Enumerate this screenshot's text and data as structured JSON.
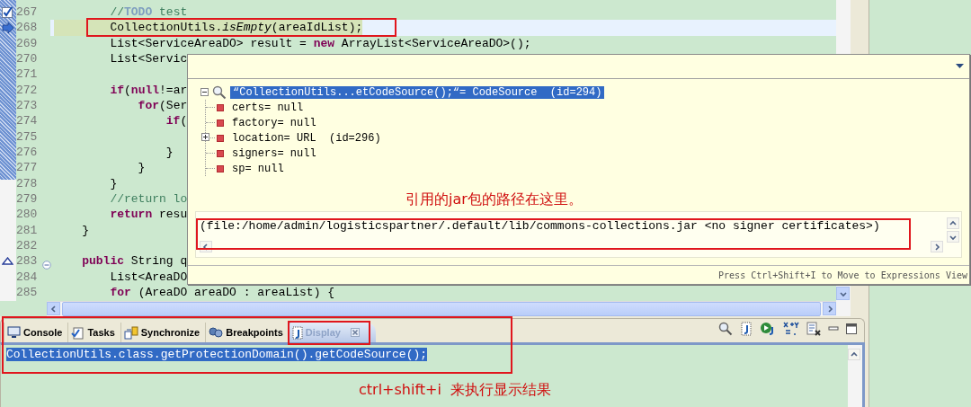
{
  "editor": {
    "lines": [
      {
        "number": "267",
        "kind": "task",
        "tokens": [
          {
            "kind": "comment",
            "text": "        //"
          },
          {
            "kind": "todo",
            "text": "TODO"
          },
          {
            "kind": "comment",
            "text": " test"
          }
        ]
      },
      {
        "number": "268",
        "kind": "pointer",
        "current": true,
        "tokens": [
          {
            "kind": "plain",
            "text": "        CollectionUtils."
          },
          {
            "kind": "italic",
            "text": "isEmpty"
          },
          {
            "kind": "plain",
            "text": "(areaIdList);"
          }
        ]
      },
      {
        "number": "269",
        "kind": "plain",
        "tokens": [
          {
            "kind": "plain",
            "text": "        List<ServiceAreaDO> result = "
          },
          {
            "kind": "keyword",
            "text": "new"
          },
          {
            "kind": "plain",
            "text": " ArrayList<ServiceAreaDO>();"
          }
        ]
      },
      {
        "number": "270",
        "kind": "plain",
        "tokens": [
          {
            "kind": "plain",
            "text": "        List<Servic"
          }
        ]
      },
      {
        "number": "271",
        "kind": "plain"
      },
      {
        "number": "272",
        "kind": "plain",
        "tokens": [
          {
            "kind": "keyword",
            "text": "        if"
          },
          {
            "kind": "plain",
            "text": "("
          },
          {
            "kind": "keyword",
            "text": "null"
          },
          {
            "kind": "plain",
            "text": "!=ar"
          }
        ]
      },
      {
        "number": "273",
        "kind": "plain",
        "tokens": [
          {
            "kind": "keyword",
            "text": "            for"
          },
          {
            "kind": "plain",
            "text": "(Ser"
          }
        ]
      },
      {
        "number": "274",
        "kind": "plain",
        "tokens": [
          {
            "kind": "keyword",
            "text": "                if"
          },
          {
            "kind": "plain",
            "text": "("
          }
        ]
      },
      {
        "number": "275",
        "kind": "plain"
      },
      {
        "number": "276",
        "kind": "plain",
        "tokens": [
          {
            "kind": "plain",
            "text": "                }"
          }
        ]
      },
      {
        "number": "277",
        "kind": "plain",
        "tokens": [
          {
            "kind": "plain",
            "text": "            }"
          }
        ]
      },
      {
        "number": "278",
        "kind": "plain",
        "tokens": [
          {
            "kind": "plain",
            "text": "        }"
          }
        ]
      },
      {
        "number": "279",
        "kind": "plain",
        "tokens": [
          {
            "kind": "comment",
            "text": "        //return lo"
          }
        ]
      },
      {
        "number": "280",
        "kind": "plain",
        "tokens": [
          {
            "kind": "keyword",
            "text": "        return"
          },
          {
            "kind": "plain",
            "text": " resu"
          }
        ]
      },
      {
        "number": "281",
        "kind": "plain",
        "tokens": [
          {
            "kind": "plain",
            "text": "    }"
          }
        ]
      },
      {
        "number": "282",
        "kind": "plain"
      },
      {
        "number": "283",
        "kind": "override",
        "foldable": true,
        "tokens": [
          {
            "kind": "keyword",
            "text": "    public"
          },
          {
            "kind": "plain",
            "text": " String q"
          }
        ]
      },
      {
        "number": "284",
        "kind": "plain",
        "tokens": [
          {
            "kind": "plain",
            "text": "        List<AreaDO"
          }
        ]
      },
      {
        "number": "285",
        "kind": "plain",
        "tokens": [
          {
            "kind": "keyword",
            "text": "        for"
          },
          {
            "kind": "plain",
            "text": " (AreaDO areaDO : areaList) {"
          }
        ]
      }
    ]
  },
  "popup": {
    "tree": {
      "label": "“CollectionUtils...etCodeSource();“= CodeSource  (id=294)",
      "selected": true,
      "expanded": true,
      "children": [
        {
          "kind": "field",
          "label": "certs= null"
        },
        {
          "kind": "field",
          "label": "factory= null"
        },
        {
          "kind": "object",
          "expanded": false,
          "label": "location= URL  (id=296)"
        },
        {
          "kind": "field",
          "label": "signers= null"
        },
        {
          "kind": "field",
          "label": "sp= null"
        }
      ]
    },
    "annotation": "引用的jar包的路径在这里。",
    "detail": "(file:/home/admin/logisticspartner/.default/lib/commons-collections.jar <no signer certificates>)",
    "hint": "Press Ctrl+Shift+I to Move to Expressions View"
  },
  "bottom": {
    "tabs": [
      {
        "kind": "console",
        "label": "Console",
        "selected": false
      },
      {
        "kind": "tasks",
        "label": "Tasks",
        "selected": false
      },
      {
        "kind": "synchronize",
        "label": "Synchronize",
        "selected": false
      },
      {
        "kind": "breakpoints",
        "label": "Breakpoints",
        "selected": false
      },
      {
        "kind": "display",
        "label": "Display",
        "selected": true
      }
    ],
    "content": {
      "text": "CollectionUtils.class.getProtectionDomain().getCodeSource();",
      "selected": true
    },
    "annotation": "ctrl+shift+i  来执行显示结果"
  }
}
